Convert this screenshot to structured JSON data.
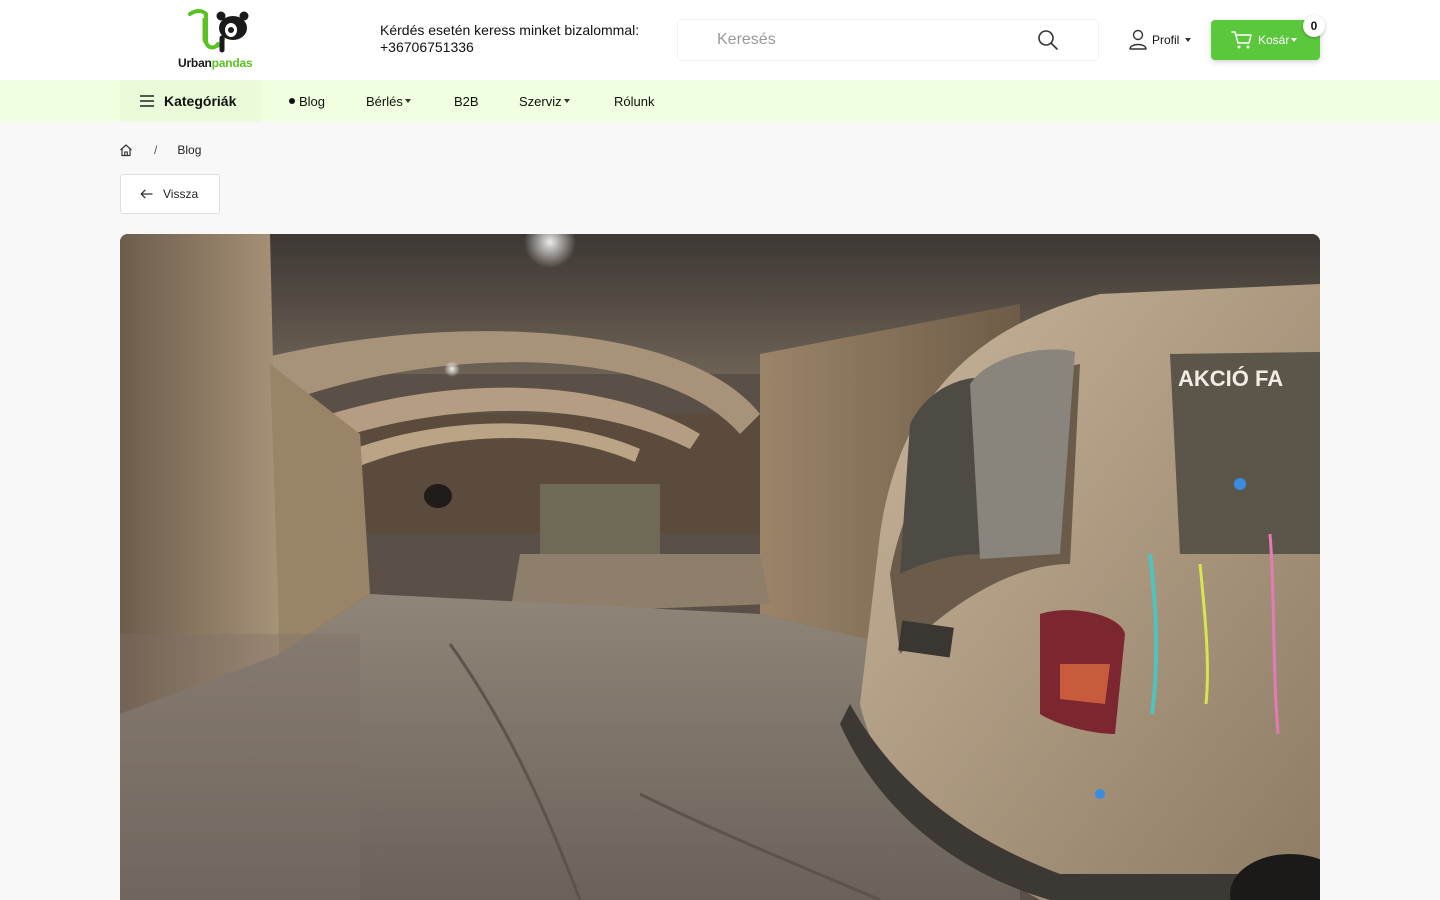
{
  "header": {
    "logo": {
      "text_part1": "Urban",
      "text_part2": "pandas"
    },
    "contact": {
      "line1": "Kérdés esetén keress minket bizalommal:",
      "line2": "+36706751336"
    },
    "search": {
      "placeholder": "Keresés",
      "icon": "search-icon"
    },
    "profile": {
      "label": "Profil",
      "icon": "user-icon"
    },
    "cart": {
      "label": "Kosár",
      "count": "0",
      "icon": "cart-icon"
    }
  },
  "nav": {
    "categories_label": "Kategóriák",
    "items": [
      {
        "label": "Blog",
        "active": true
      },
      {
        "label": "Bérlés",
        "dropdown": true
      },
      {
        "label": "B2B"
      },
      {
        "label": "Szerviz",
        "dropdown": true
      },
      {
        "label": "Rólunk"
      }
    ]
  },
  "breadcrumb": {
    "home_icon": "home-icon",
    "separator": "/",
    "current": "Blog"
  },
  "back_button": {
    "label": "Vissza",
    "icon": "arrow-left-icon"
  },
  "hero": {
    "image": "underground-tunnel-with-painted-van",
    "van_text": "AKCIÓ FA"
  },
  "colors": {
    "brand_green": "#5ac73c",
    "nav_background": "#efffdf",
    "page_background": "#f8f8f8"
  }
}
